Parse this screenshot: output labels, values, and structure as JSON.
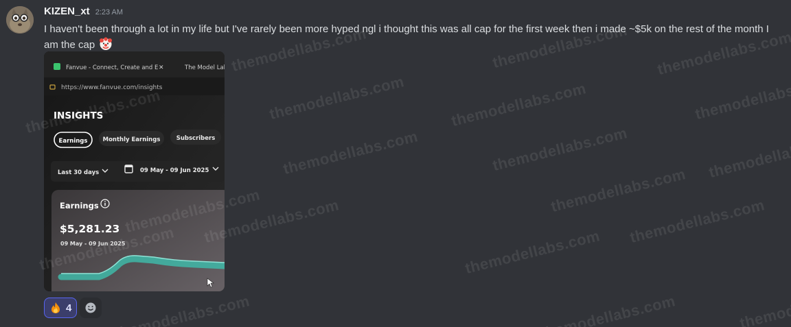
{
  "message": {
    "username": "KIZEN_xt",
    "timestamp": "2:23 AM",
    "text": "I haven't been through a lot in my life but I've rarely been more hyped ngl i thought this was all cap for the first week then i made ~$5k on the rest of the month I am the cap",
    "trailing_emoji": "clown-face-emoji"
  },
  "attachment": {
    "browser_tab_1": "Fanvue - Connect, Create and E",
    "browser_tab_close": "✕",
    "browser_tab_2": "The Model Labs",
    "url": "https://www.fanvue.com/insights",
    "page_title": "INSIGHTS",
    "tabs": [
      "Earnings",
      "Monthly Earnings",
      "Subscribers"
    ],
    "range_select": "Last 30 days",
    "date_range": "09 May - 09 Jun 2025",
    "card_title": "Earnings",
    "card_value": "$5,281.23",
    "card_subtitle": "09 May - 09 Jun 2025"
  },
  "reactions": [
    {
      "icon": "fire-emoji",
      "count": "4",
      "active": true
    }
  ],
  "add_reaction_icon": "smiley-add-reaction-icon",
  "watermark": "themodellabs.com",
  "colors": {
    "background": "#313338",
    "accent": "#5865f2",
    "chart_line": "#3fb8a8"
  }
}
